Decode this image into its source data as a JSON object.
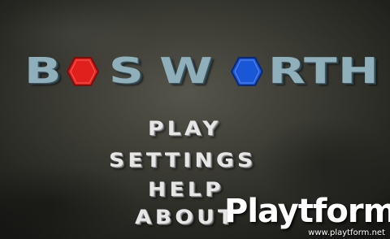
{
  "game": {
    "title_letters": [
      "B",
      "S",
      "W",
      "R",
      "T",
      "H"
    ],
    "title_gems": [
      {
        "name": "red-gem",
        "color": "#e0201c"
      },
      {
        "name": "blue-gem",
        "color": "#1a57d6"
      }
    ],
    "title_color": "#8fb0bb"
  },
  "menu": {
    "play": "PLAY",
    "settings": "SETTINGS",
    "help": "HELP",
    "about": "ABOUT"
  },
  "watermark": {
    "brand": "Playtform",
    "url": "www.playtform.net"
  }
}
